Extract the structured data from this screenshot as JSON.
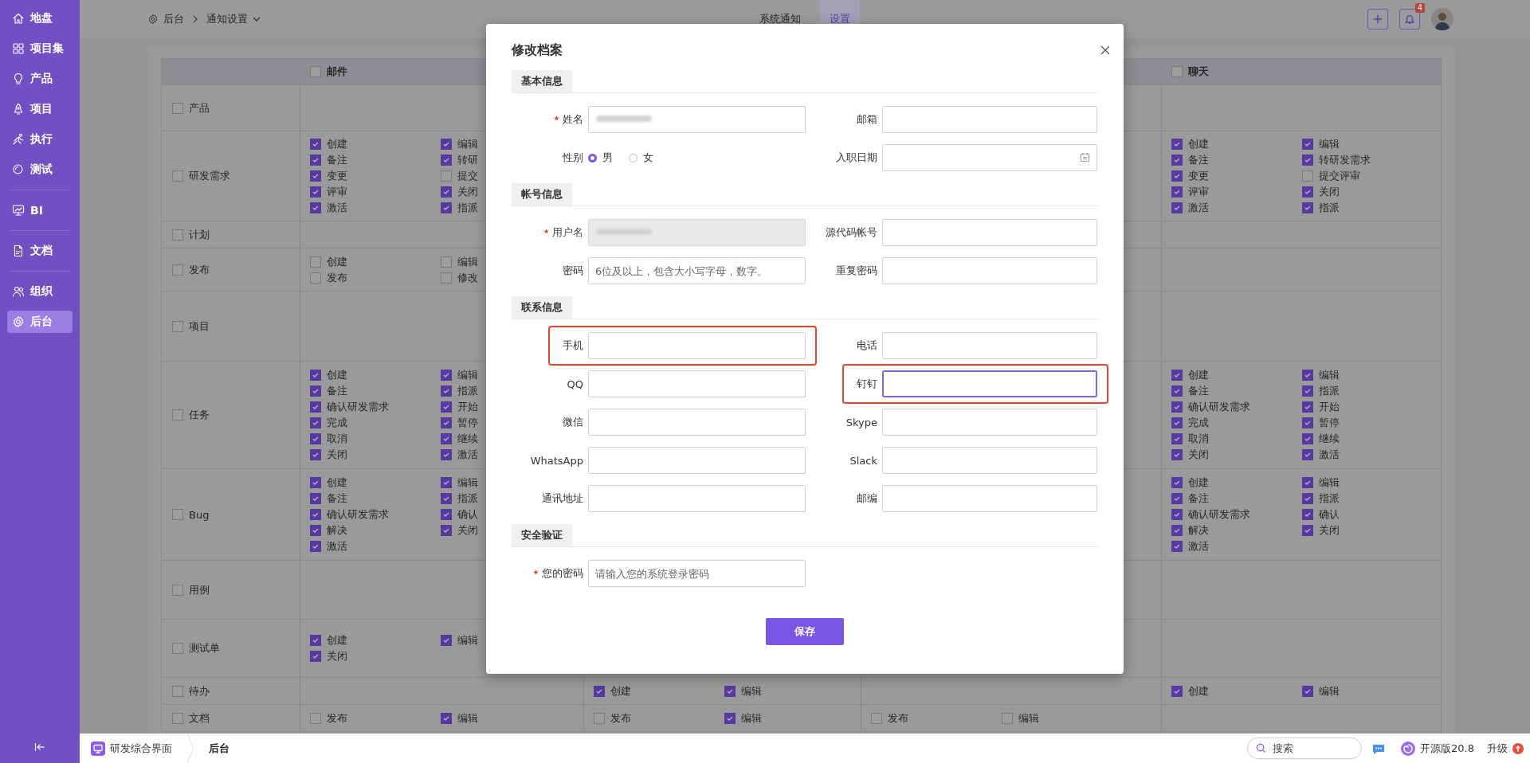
{
  "sidebar": {
    "items": [
      {
        "label": "地盘",
        "selected": false
      },
      {
        "label": "项目集",
        "selected": false
      },
      {
        "label": "产品",
        "selected": false
      },
      {
        "label": "项目",
        "selected": false
      },
      {
        "label": "执行",
        "selected": false
      },
      {
        "label": "测试",
        "selected": false
      },
      {
        "label": "BI",
        "selected": false
      },
      {
        "label": "文档",
        "selected": false
      },
      {
        "label": "组织",
        "selected": false
      },
      {
        "label": "后台",
        "selected": true
      }
    ]
  },
  "top_bar": {
    "breadcrumb": [
      "后台",
      "通知设置"
    ],
    "tabs": [
      {
        "label": "系统通知",
        "selected": false
      },
      {
        "label": "设置",
        "selected": true
      }
    ],
    "notification_count": "4"
  },
  "table": {
    "columns": [
      {
        "label": "邮件",
        "checked": false
      },
      {},
      {},
      {
        "label": "聊天",
        "checked": false
      }
    ],
    "rows": [
      {
        "label": "产品",
        "checked": false,
        "cells": [
          {},
          {},
          {},
          {}
        ]
      },
      {
        "label": "研发需求",
        "checked": false,
        "cells": [
          {
            "left": [
              {
                "label": "创建",
                "checked": true
              },
              {
                "label": "备注",
                "checked": true
              },
              {
                "label": "变更",
                "checked": true
              },
              {
                "label": "评审",
                "checked": true
              },
              {
                "label": "激活",
                "checked": true
              }
            ],
            "right": [
              {
                "label": "编辑",
                "checked": true
              },
              {
                "label": "转研",
                "checked": true
              },
              {
                "label": "提交",
                "checked": false
              },
              {
                "label": "关闭",
                "checked": true
              },
              {
                "label": "指派",
                "checked": true
              }
            ]
          },
          {},
          {},
          {
            "left": [
              {
                "label": "创建",
                "checked": true
              },
              {
                "label": "备注",
                "checked": true
              },
              {
                "label": "变更",
                "checked": true
              },
              {
                "label": "评审",
                "checked": true
              },
              {
                "label": "激活",
                "checked": true
              }
            ],
            "right": [
              {
                "label": "编辑",
                "checked": true
              },
              {
                "label": "转研发需求",
                "checked": true
              },
              {
                "label": "提交评审",
                "checked": false
              },
              {
                "label": "关闭",
                "checked": true
              },
              {
                "label": "指派",
                "checked": true
              }
            ]
          }
        ]
      },
      {
        "label": "计划",
        "checked": false,
        "cells": [
          {},
          {},
          {},
          {}
        ]
      },
      {
        "label": "发布",
        "checked": false,
        "cells": [
          {
            "left": [
              {
                "label": "创建",
                "checked": false
              },
              {
                "label": "发布",
                "checked": false
              }
            ],
            "right": [
              {
                "label": "编辑",
                "checked": false
              },
              {
                "label": "修改",
                "checked": false
              }
            ]
          },
          {},
          {},
          {}
        ]
      },
      {
        "label": "项目",
        "checked": false,
        "cells": [
          {},
          {},
          {},
          {}
        ]
      },
      {
        "label": "任务",
        "checked": false,
        "cells": [
          {
            "left": [
              {
                "label": "创建",
                "checked": true
              },
              {
                "label": "备注",
                "checked": true
              },
              {
                "label": "确认研发需求",
                "checked": true
              },
              {
                "label": "完成",
                "checked": true
              },
              {
                "label": "取消",
                "checked": true
              },
              {
                "label": "关闭",
                "checked": true
              }
            ],
            "right": [
              {
                "label": "编辑",
                "checked": true
              },
              {
                "label": "指派",
                "checked": true
              },
              {
                "label": "开始",
                "checked": true
              },
              {
                "label": "暂停",
                "checked": true
              },
              {
                "label": "继续",
                "checked": true
              },
              {
                "label": "激活",
                "checked": true
              }
            ]
          },
          {},
          {},
          {
            "left": [
              {
                "label": "创建",
                "checked": true
              },
              {
                "label": "备注",
                "checked": true
              },
              {
                "label": "确认研发需求",
                "checked": true
              },
              {
                "label": "完成",
                "checked": true
              },
              {
                "label": "取消",
                "checked": true
              },
              {
                "label": "关闭",
                "checked": true
              }
            ],
            "right": [
              {
                "label": "编辑",
                "checked": true
              },
              {
                "label": "指派",
                "checked": true
              },
              {
                "label": "开始",
                "checked": true
              },
              {
                "label": "暂停",
                "checked": true
              },
              {
                "label": "继续",
                "checked": true
              },
              {
                "label": "激活",
                "checked": true
              }
            ]
          }
        ]
      },
      {
        "label": "Bug",
        "checked": false,
        "cells": [
          {
            "left": [
              {
                "label": "创建",
                "checked": true
              },
              {
                "label": "备注",
                "checked": true
              },
              {
                "label": "确认研发需求",
                "checked": true
              },
              {
                "label": "解决",
                "checked": true
              },
              {
                "label": "激活",
                "checked": true
              }
            ],
            "right": [
              {
                "label": "编辑",
                "checked": true
              },
              {
                "label": "指派",
                "checked": true
              },
              {
                "label": "确认",
                "checked": true
              },
              {
                "label": "关闭",
                "checked": true
              }
            ]
          },
          {},
          {},
          {
            "left": [
              {
                "label": "创建",
                "checked": true
              },
              {
                "label": "备注",
                "checked": true
              },
              {
                "label": "确认研发需求",
                "checked": true
              },
              {
                "label": "解决",
                "checked": true
              },
              {
                "label": "激活",
                "checked": true
              }
            ],
            "right": [
              {
                "label": "编辑",
                "checked": true
              },
              {
                "label": "指派",
                "checked": true
              },
              {
                "label": "确认",
                "checked": true
              },
              {
                "label": "关闭",
                "checked": true
              }
            ]
          }
        ]
      },
      {
        "label": "用例",
        "checked": false,
        "cells": [
          {},
          {},
          {},
          {}
        ]
      },
      {
        "label": "测试单",
        "checked": false,
        "cells": [
          {
            "left": [
              {
                "label": "创建",
                "checked": true
              },
              {
                "label": "关闭",
                "checked": true
              }
            ],
            "right": [
              {
                "label": "编辑",
                "checked": true
              }
            ]
          },
          {},
          {},
          {}
        ]
      },
      {
        "label": "待办",
        "checked": false,
        "cells": [
          {},
          {
            "left": [
              {
                "label": "创建",
                "checked": true
              }
            ],
            "right": [
              {
                "label": "编辑",
                "checked": true
              }
            ]
          },
          {},
          {
            "left": [
              {
                "label": "创建",
                "checked": true
              }
            ],
            "right": [
              {
                "label": "编辑",
                "checked": true
              }
            ]
          }
        ]
      },
      {
        "label": "文档",
        "checked": false,
        "cells": [
          {
            "left": [
              {
                "label": "发布",
                "checked": false
              }
            ],
            "right": [
              {
                "label": "编辑",
                "checked": true
              }
            ]
          },
          {
            "left": [
              {
                "label": "发布",
                "checked": false
              }
            ],
            "right": [
              {
                "label": "编辑",
                "checked": true
              }
            ]
          },
          {
            "left": [
              {
                "label": "发布",
                "checked": false
              }
            ],
            "right": [
              {
                "label": "编辑",
                "checked": false
              }
            ]
          },
          {}
        ]
      }
    ]
  },
  "dialog": {
    "title": "修改档案",
    "sections": [
      {
        "title": "基本信息",
        "fields": [
          {
            "kind": "text",
            "label": "姓名",
            "required": true,
            "disabled": false,
            "redacted": true,
            "focused": false,
            "highlighted": false
          },
          {
            "kind": "text",
            "label": "邮箱",
            "required": false,
            "disabled": false,
            "redacted": false,
            "focused": false,
            "highlighted": false
          },
          {
            "kind": "radio",
            "label": "性别",
            "required": false,
            "disabled": false,
            "redacted": false,
            "focused": false,
            "highlighted": false,
            "options": [
              {
                "label": "男",
                "selected": true
              },
              {
                "label": "女",
                "selected": false
              }
            ]
          },
          {
            "kind": "date",
            "label": "入职日期",
            "required": false,
            "disabled": false,
            "redacted": false,
            "focused": false,
            "highlighted": false
          }
        ]
      },
      {
        "title": "帐号信息",
        "fields": [
          {
            "kind": "text",
            "label": "用户名",
            "required": true,
            "disabled": true,
            "redacted": true,
            "focused": false,
            "highlighted": false
          },
          {
            "kind": "text",
            "label": "源代码帐号",
            "required": false,
            "disabled": false,
            "redacted": false,
            "focused": false,
            "highlighted": false
          },
          {
            "kind": "text",
            "label": "密码",
            "required": false,
            "disabled": false,
            "redacted": false,
            "focused": false,
            "highlighted": false,
            "placeholder": "6位及以上，包含大小写字母，数字。"
          },
          {
            "kind": "text",
            "label": "重复密码",
            "required": false,
            "disabled": false,
            "redacted": false,
            "focused": false,
            "highlighted": false
          }
        ]
      },
      {
        "title": "联系信息",
        "fields": [
          {
            "kind": "text",
            "label": "手机",
            "required": false,
            "disabled": false,
            "redacted": false,
            "focused": false,
            "highlighted": true
          },
          {
            "kind": "text",
            "label": "电话",
            "required": false,
            "disabled": false,
            "redacted": false,
            "focused": false,
            "highlighted": false
          },
          {
            "kind": "text",
            "label": "QQ",
            "required": false,
            "disabled": false,
            "redacted": false,
            "focused": false,
            "highlighted": false
          },
          {
            "kind": "text",
            "label": "钉钉",
            "required": false,
            "disabled": false,
            "redacted": false,
            "focused": true,
            "highlighted": true
          },
          {
            "kind": "text",
            "label": "微信",
            "required": false,
            "disabled": false,
            "redacted": false,
            "focused": false,
            "highlighted": false
          },
          {
            "kind": "text",
            "label": "Skype",
            "required": false,
            "disabled": false,
            "redacted": false,
            "focused": false,
            "highlighted": false
          },
          {
            "kind": "text",
            "label": "WhatsApp",
            "required": false,
            "disabled": false,
            "redacted": false,
            "focused": false,
            "highlighted": false
          },
          {
            "kind": "text",
            "label": "Slack",
            "required": false,
            "disabled": false,
            "redacted": false,
            "focused": false,
            "highlighted": false
          },
          {
            "kind": "text",
            "label": "通讯地址",
            "required": false,
            "disabled": false,
            "redacted": false,
            "focused": false,
            "highlighted": false
          },
          {
            "kind": "text",
            "label": "邮编",
            "required": false,
            "disabled": false,
            "redacted": false,
            "focused": false,
            "highlighted": false
          }
        ]
      },
      {
        "title": "安全验证",
        "fields": [
          {
            "kind": "text",
            "label": "您的密码",
            "required": true,
            "disabled": false,
            "redacted": false,
            "focused": false,
            "highlighted": false,
            "placeholder": "请输入您的系统登录密码"
          }
        ]
      }
    ],
    "save_button": "保存"
  },
  "bottom_bar": {
    "app": "研发综合界面",
    "page": "后台",
    "search_placeholder": "搜索",
    "version": "开源版20.8",
    "upgrade": "升级"
  }
}
